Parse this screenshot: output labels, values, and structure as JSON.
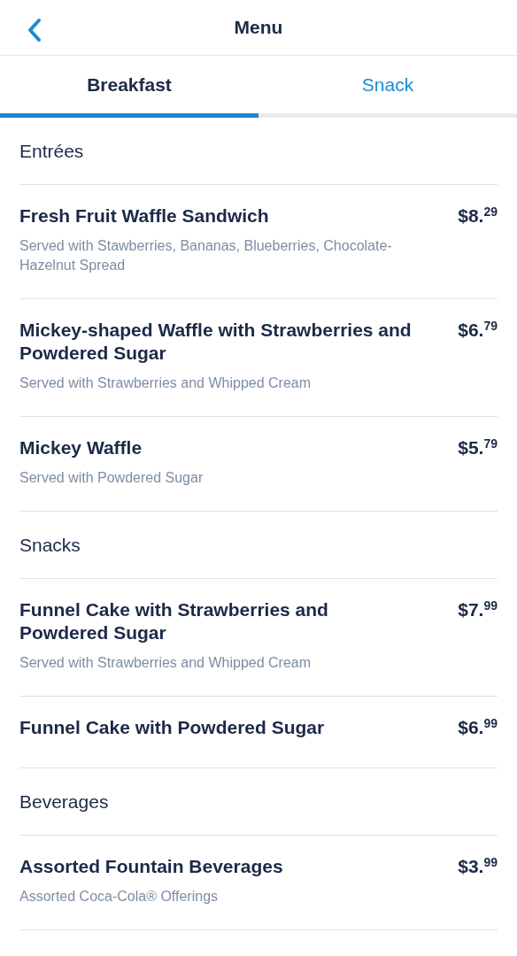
{
  "header": {
    "title": "Menu"
  },
  "tabs": [
    {
      "label": "Breakfast",
      "selected": true
    },
    {
      "label": "Snack",
      "selected": false
    }
  ],
  "sections": [
    {
      "title": "Entrées",
      "items": [
        {
          "name": "Fresh Fruit Waffle Sandwich",
          "price": "$8.$^{29}$",
          "description": "Served with Stawberries, Bananas, Blueberries, Chocolate-Hazelnut Spread"
        },
        {
          "name": "Mickey-shaped Waffle with Strawberries and Powdered Sugar",
          "price": "$6.$^{79}$",
          "description": "Served with Strawberries and Whipped Cream"
        },
        {
          "name": "Mickey Waffle",
          "price": "$5.$^{79}$",
          "description": "Served with Powdered Sugar"
        }
      ]
    },
    {
      "title": "Snacks",
      "items": [
        {
          "name": "Funnel Cake with Strawberries and Powdered Sugar",
          "price": "$7.$^{99}$",
          "description": "Served with Strawberries and Whipped Cream"
        },
        {
          "name": "Funnel Cake with Powdered Sugar",
          "price": "$6.$^{99}$"
        }
      ]
    },
    {
      "title": "Beverages",
      "items": [
        {
          "name": "Assorted Fountain Beverages",
          "price": "$3.$^{99}$",
          "description": "Assorted Coca-Cola® Offerings"
        }
      ]
    }
  ]
}
